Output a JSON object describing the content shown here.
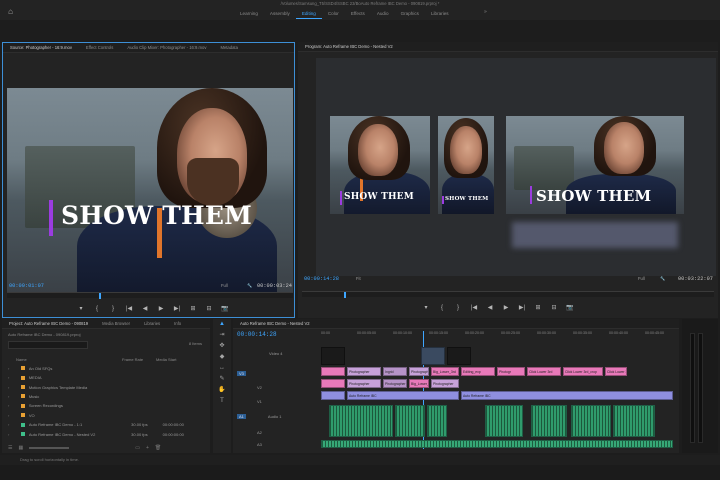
{
  "app": {
    "title": "/Volumes/Samsung_T5/SSD4/SSBC 23/BoAuto Reframe IBC Demo - 090819.prproj *",
    "workspaces": [
      "Learning",
      "Assembly",
      "Editing",
      "Color",
      "Effects",
      "Audio",
      "Graphics",
      "Libraries"
    ],
    "active_workspace": "Editing",
    "more": "»"
  },
  "source": {
    "tabs": [
      "Source: Photographer - 16:9.mov",
      "Effect Controls",
      "Audio Clip Mixer: Photographer - 16:9.mov",
      "Metadata"
    ],
    "caption": "SHOW THEM",
    "timecode_in": "00:00:01:07",
    "fit": "Full",
    "timecode_out": "00:00:03:24",
    "controls": [
      "▾",
      "{",
      "}",
      "|◀",
      "◀",
      "▶",
      "▶|",
      "⊞",
      "⊟",
      "📷"
    ]
  },
  "program": {
    "tabs": [
      "Program: Auto Reframe IBC Demo - Nested V2"
    ],
    "caption": "SHOW THEM",
    "timecode_in": "00:00:14:28",
    "fit": "Fit",
    "full": "Full",
    "timecode_out": "00:03:22:07",
    "controls": [
      "▾",
      "{",
      "}",
      "|◀",
      "◀",
      "▶",
      "▶|",
      "⊞",
      "⊟",
      "📷"
    ]
  },
  "project": {
    "tabs": [
      "Project: Auto Reframe IBC Demo - 090819",
      "Media Browser",
      "Libraries",
      "Info"
    ],
    "file": "Auto Reframe IBC Demo - 090819.prproj",
    "items_count": "8 Items",
    "columns": [
      "Name",
      "Frame Rate",
      "Media Start"
    ],
    "rows": [
      {
        "name": "An Old SFQs",
        "rate": "",
        "start": "",
        "color": "#e8a033"
      },
      {
        "name": "MEDIA",
        "rate": "",
        "start": "",
        "color": "#e8a033"
      },
      {
        "name": "Motion Graphics Template Media",
        "rate": "",
        "start": "",
        "color": "#e8a033"
      },
      {
        "name": "Music",
        "rate": "",
        "start": "",
        "color": "#e8a033"
      },
      {
        "name": "Screen Recordings",
        "rate": "",
        "start": "",
        "color": "#e8a033"
      },
      {
        "name": "VO",
        "rate": "",
        "start": "",
        "color": "#e8a033"
      },
      {
        "name": "Auto Reframe IBC Demo - 1:1",
        "rate": "30.00 fps",
        "start": "00:00:00:00",
        "color": "#3fbf8a"
      },
      {
        "name": "Auto Reframe IBC Demo - Nested V2",
        "rate": "30.00 fps",
        "start": "00:00:00:00",
        "color": "#3fbf8a"
      }
    ]
  },
  "timeline": {
    "tab": "Auto Reframe IBC Demo - Nested V2",
    "timecode": "00:00:14:28",
    "ruler": [
      "00:00",
      "00:00:05:00",
      "00:00:10:00",
      "00:00:15:00",
      "00:00:20:00",
      "00:00:25:00",
      "00:00:30:00",
      "00:00:35:00",
      "00:00:40:00",
      "00:00:45:00"
    ],
    "tracks": {
      "v4": "Video 4",
      "v3": "V3",
      "v2": "V2",
      "v1": "V1",
      "a1": "Audio 1",
      "a2": "A2",
      "a3": "A3"
    },
    "clips_v2": [
      "Photographer",
      "Ingrid",
      "Photographer",
      "Big_Lower_3rd",
      "Editing_exp",
      "Photogr",
      "Click Lower 3rd",
      "Click Lower 3rd_crop",
      "Click Lower 3rd"
    ],
    "clips_v1": [
      "Photographer",
      "Photographer",
      "Big_Lower_3rd",
      "Photographer",
      "Auto Reframe IBC",
      "Auto Reframe IBC"
    ]
  },
  "status": {
    "text": "Drag to scroll horizontally in time."
  }
}
